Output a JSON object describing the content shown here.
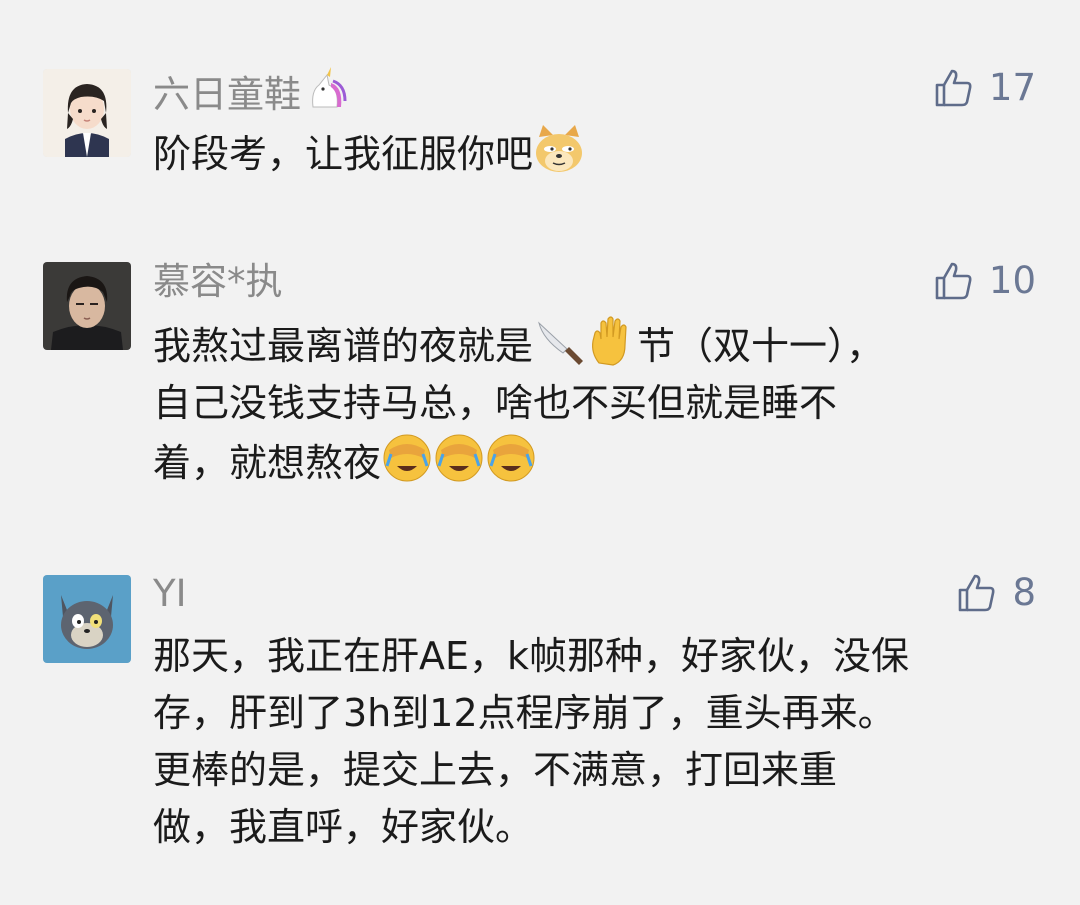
{
  "comments": [
    {
      "username": "六日童鞋",
      "username_emoji": "unicorn-emoji",
      "likes": "17",
      "lines": [
        "阶段考，让我征服你吧"
      ],
      "trailing_emoji": "doge-emoji"
    },
    {
      "username": "慕容*执",
      "likes": "10",
      "line1_a": "我熬过最离谱的夜就是",
      "line1_b": "节（双十一），",
      "line2": "自己没钱支持马总，啥也不买但就是睡不",
      "line3": "着，就想熬夜",
      "emojis": [
        "knife-emoji",
        "raised-hand-emoji",
        "facepalm-cry-emoji"
      ]
    },
    {
      "username": "YI",
      "likes": "8",
      "lines": [
        "那天，我正在肝AE，k帧那种，好家伙，没保",
        "存，肝到了3h到12点程序崩了，重头再来。",
        "更棒的是，提交上去，不满意，打回来重",
        "做，我直呼，好家伙。"
      ]
    }
  ],
  "colors": {
    "background": "#f2f2f2",
    "username": "#8a8a8a",
    "like_icon": "#5f6c8a",
    "text": "#1b1b1b"
  },
  "icons": {
    "like": "thumbs-up-outline-icon"
  }
}
